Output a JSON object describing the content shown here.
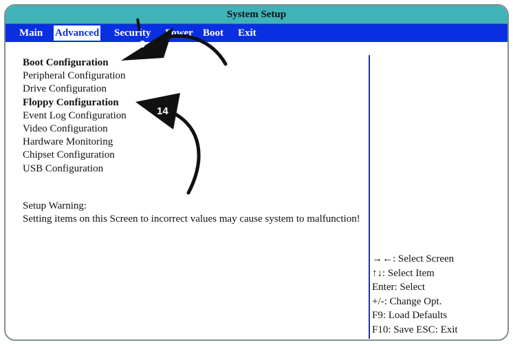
{
  "window": {
    "title": "System Setup"
  },
  "menu": {
    "items": [
      "Main",
      "Advanced",
      "Security",
      "Power",
      "Boot",
      "Exit"
    ],
    "active": "Advanced"
  },
  "configs": [
    {
      "label": "Boot Configuration",
      "bold": true
    },
    {
      "label": "Peripheral Configuration",
      "bold": false
    },
    {
      "label": "Drive Configuration",
      "bold": false
    },
    {
      "label": "Floppy Configuration",
      "bold": true
    },
    {
      "label": "Event Log Configuration",
      "bold": false
    },
    {
      "label": "Video Configuration",
      "bold": false
    },
    {
      "label": "Hardware Monitoring",
      "bold": false
    },
    {
      "label": "Chipset Configuration",
      "bold": false
    },
    {
      "label": "USB Configuration",
      "bold": false
    }
  ],
  "warning": {
    "title": "Setup Warning:",
    "text": "Setting items on this Screen to incorrect values may cause system to malfunction!"
  },
  "help": [
    "→←: Select Screen",
    "↑↓: Select Item",
    "Enter: Select",
    "+/-: Change Opt.",
    "F9: Load Defaults",
    "F10: Save ESC: Exit"
  ],
  "callouts": [
    "9",
    "14"
  ],
  "colors": {
    "title_bg": "#3fb3b8",
    "menu_bg": "#0a2fe0",
    "divider": "#2a2ab0"
  }
}
